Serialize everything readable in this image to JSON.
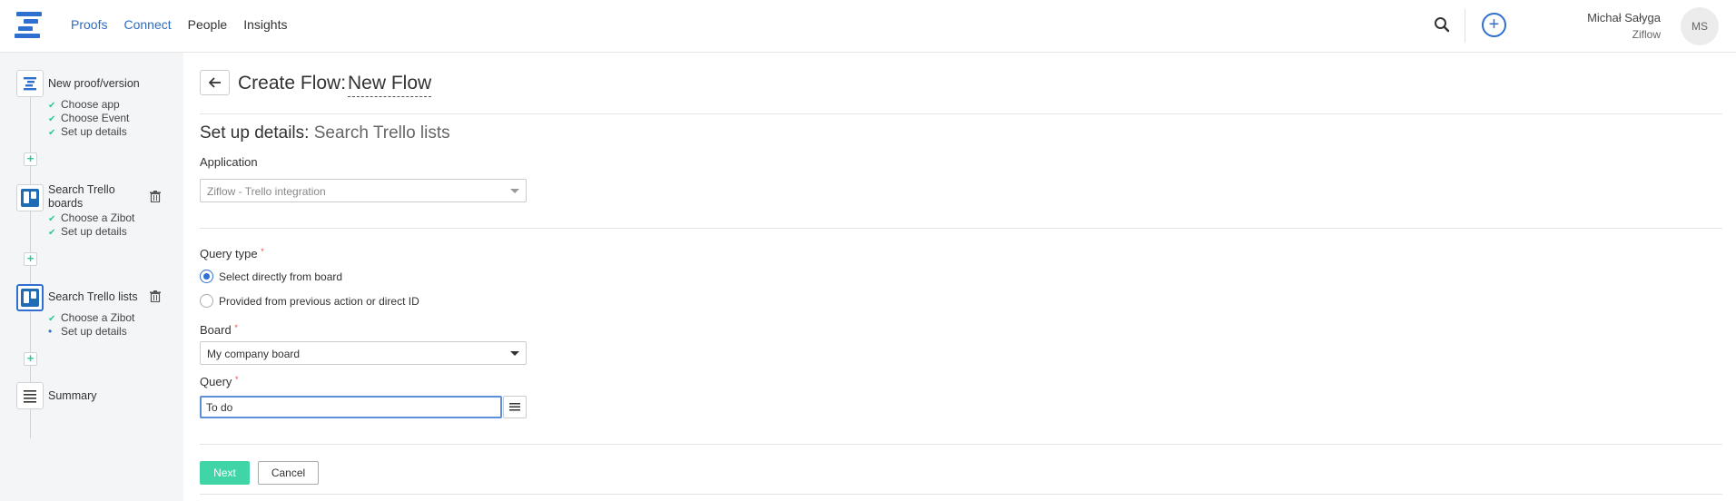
{
  "nav": {
    "items": [
      "Proofs",
      "Connect",
      "People",
      "Insights"
    ]
  },
  "user": {
    "name": "Michał Sałyga",
    "org": "Ziflow",
    "initials": "MS"
  },
  "sidebar": {
    "steps": [
      {
        "title": "New proof/version",
        "subs": [
          "Choose app",
          "Choose Event",
          "Set up details"
        ]
      },
      {
        "title": "Search Trello boards",
        "subs": [
          "Choose a Zibot",
          "Set up details"
        ]
      },
      {
        "title": "Search Trello lists",
        "subs": [
          "Choose a Zibot",
          "Set up details"
        ]
      },
      {
        "title": "Summary"
      }
    ]
  },
  "page": {
    "title_prefix": "Create Flow:",
    "flow_name": "New Flow",
    "section_prefix": "Set up details:",
    "section_name": "Search Trello lists"
  },
  "form": {
    "application_label": "Application",
    "application_value": "Ziflow - Trello integration",
    "query_type_label": "Query type",
    "query_type_options": [
      "Select directly from board",
      "Provided from previous action or direct ID"
    ],
    "board_label": "Board",
    "board_value": "My company board",
    "query_label": "Query",
    "query_value": "To do",
    "required_mark": "*"
  },
  "buttons": {
    "next": "Next",
    "cancel": "Cancel"
  },
  "colors": {
    "brand": "#2f6fd0",
    "accent_green": "#3fd5a6",
    "check": "#2ec79b"
  }
}
